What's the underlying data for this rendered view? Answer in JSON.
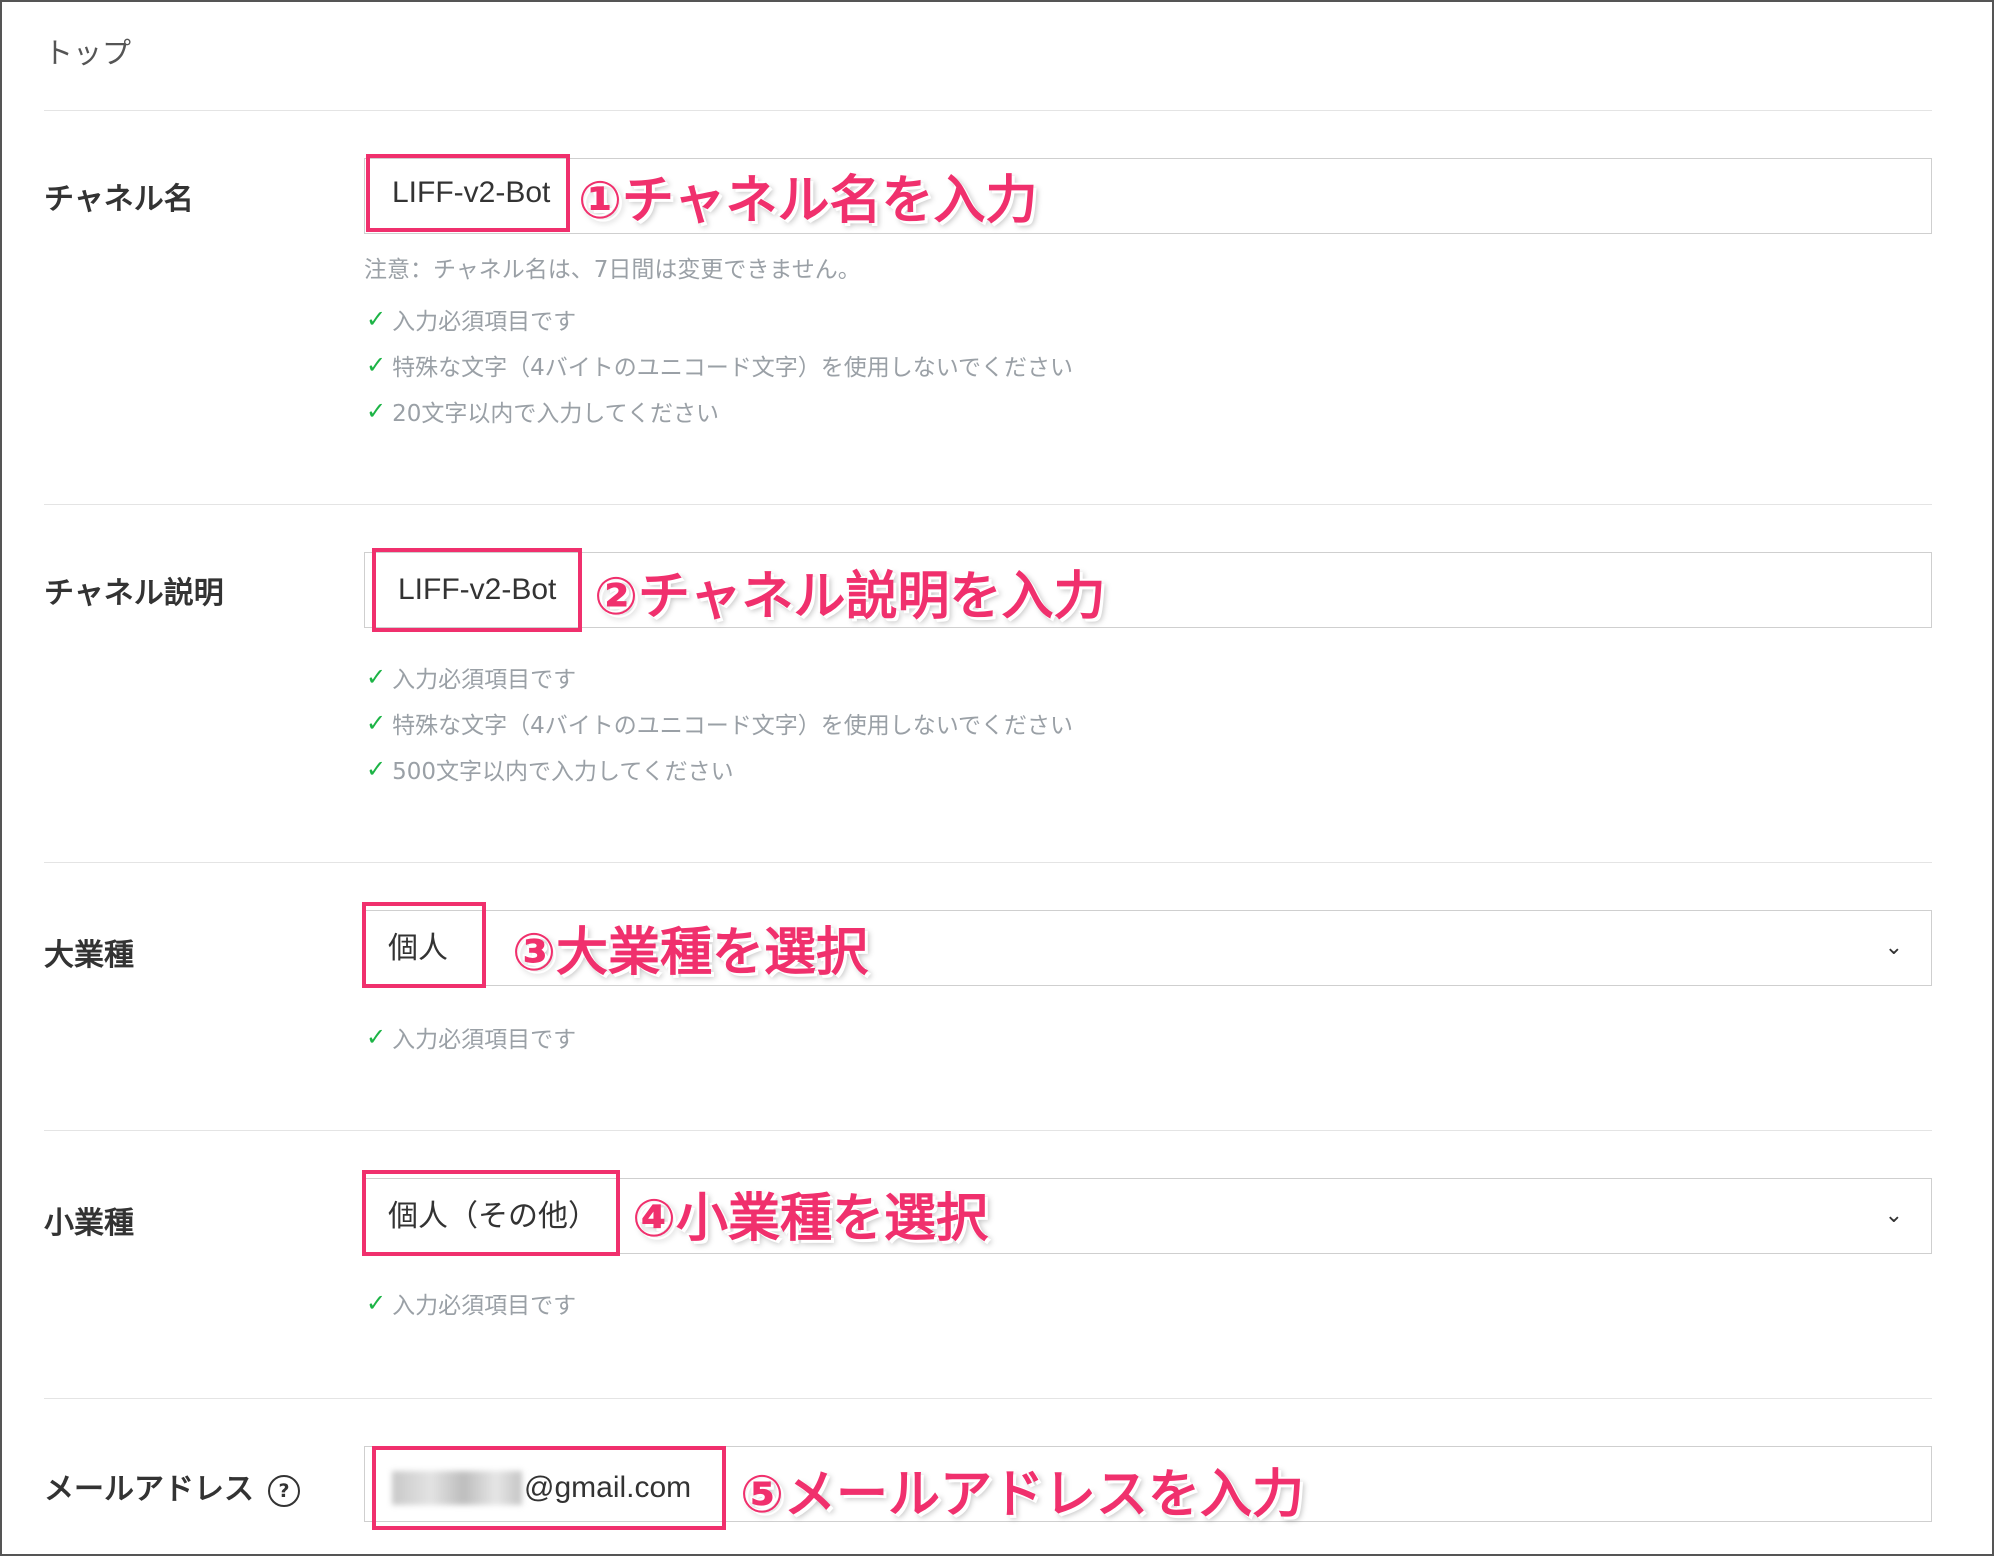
{
  "breadcrumb": "トップ",
  "sections": {
    "channel_name": {
      "label": "チャネル名",
      "value": "LIFF-v2-Bot",
      "annotation": "①チャネル名を入力",
      "note": "注意：チャネル名は、7日間は変更できません。",
      "checks": [
        "入力必須項目です",
        "特殊な文字（4バイトのユニコード文字）を使用しないでください",
        "20文字以内で入力してください"
      ]
    },
    "channel_desc": {
      "label": "チャネル説明",
      "value": "LIFF-v2-Bot",
      "annotation": "②チャネル説明を入力",
      "checks": [
        "入力必須項目です",
        "特殊な文字（4バイトのユニコード文字）を使用しないでください",
        "500文字以内で入力してください"
      ]
    },
    "major_industry": {
      "label": "大業種",
      "value": "個人",
      "annotation": "③大業種を選択",
      "checks": [
        "入力必須項目です"
      ]
    },
    "minor_industry": {
      "label": "小業種",
      "value": "個人（その他）",
      "annotation": "④小業種を選択",
      "checks": [
        "入力必須項目です"
      ]
    },
    "email": {
      "label": "メールアドレス",
      "value": "@gmail.com",
      "annotation": "⑤メールアドレスを入力"
    }
  },
  "icons": {
    "check": "check-icon",
    "chevron": "chevron-down-icon",
    "help": "question-circle-icon"
  },
  "colors": {
    "annotation": "#f0306d",
    "check": "#1db446",
    "hint_text": "#9aa0a6"
  }
}
